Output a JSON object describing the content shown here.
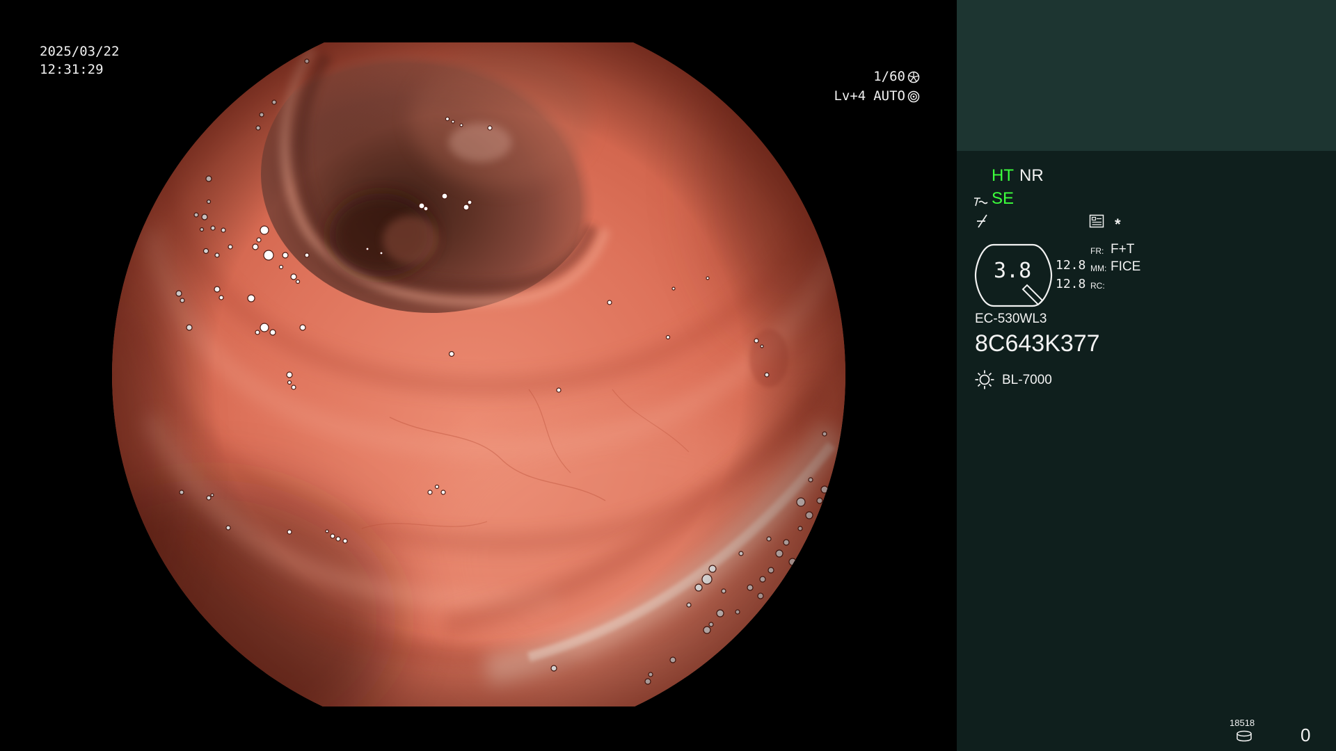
{
  "overlay": {
    "date": "2025/03/22",
    "time": "12:31:29",
    "shutter_speed": "1/60",
    "enhancement_level": "Lv+4",
    "iris_mode": "AUTO"
  },
  "panel": {
    "ht": "HT",
    "nr": "NR",
    "se": "SE",
    "memo_marker": "*",
    "zoom": "3.8",
    "value_1": "12.8",
    "value_2": "12.8",
    "fr_label": "FR:",
    "fr_value": "F+T",
    "mm_label": "MM:",
    "mm_value": "FICE",
    "rc_label": "RC:",
    "scope_model": "EC-530WL3",
    "scope_serial": "8C643K377",
    "light_source": "BL-7000",
    "image_counter": "18518",
    "storage_count": "0"
  },
  "colors": {
    "background": "#000000",
    "panel": "#0f1f1d",
    "panel_header": "#1d3531",
    "text": "#f2f2f2",
    "active_indicator": "#3cff3c",
    "mucosa": "#dc7059",
    "lumen": "#4a271c"
  },
  "icons": {
    "shutter": "shutter-icon",
    "iris": "iris-auto-icon",
    "structure_enhancement": "structure-enhancement-icon",
    "gamma": "gamma-slash-icon",
    "memo": "memo-icon",
    "zoom_frame": "zoom-frame-icon",
    "scope_tip": "scope-tip-icon",
    "light": "light-source-icon",
    "storage": "storage-disk-icon"
  }
}
